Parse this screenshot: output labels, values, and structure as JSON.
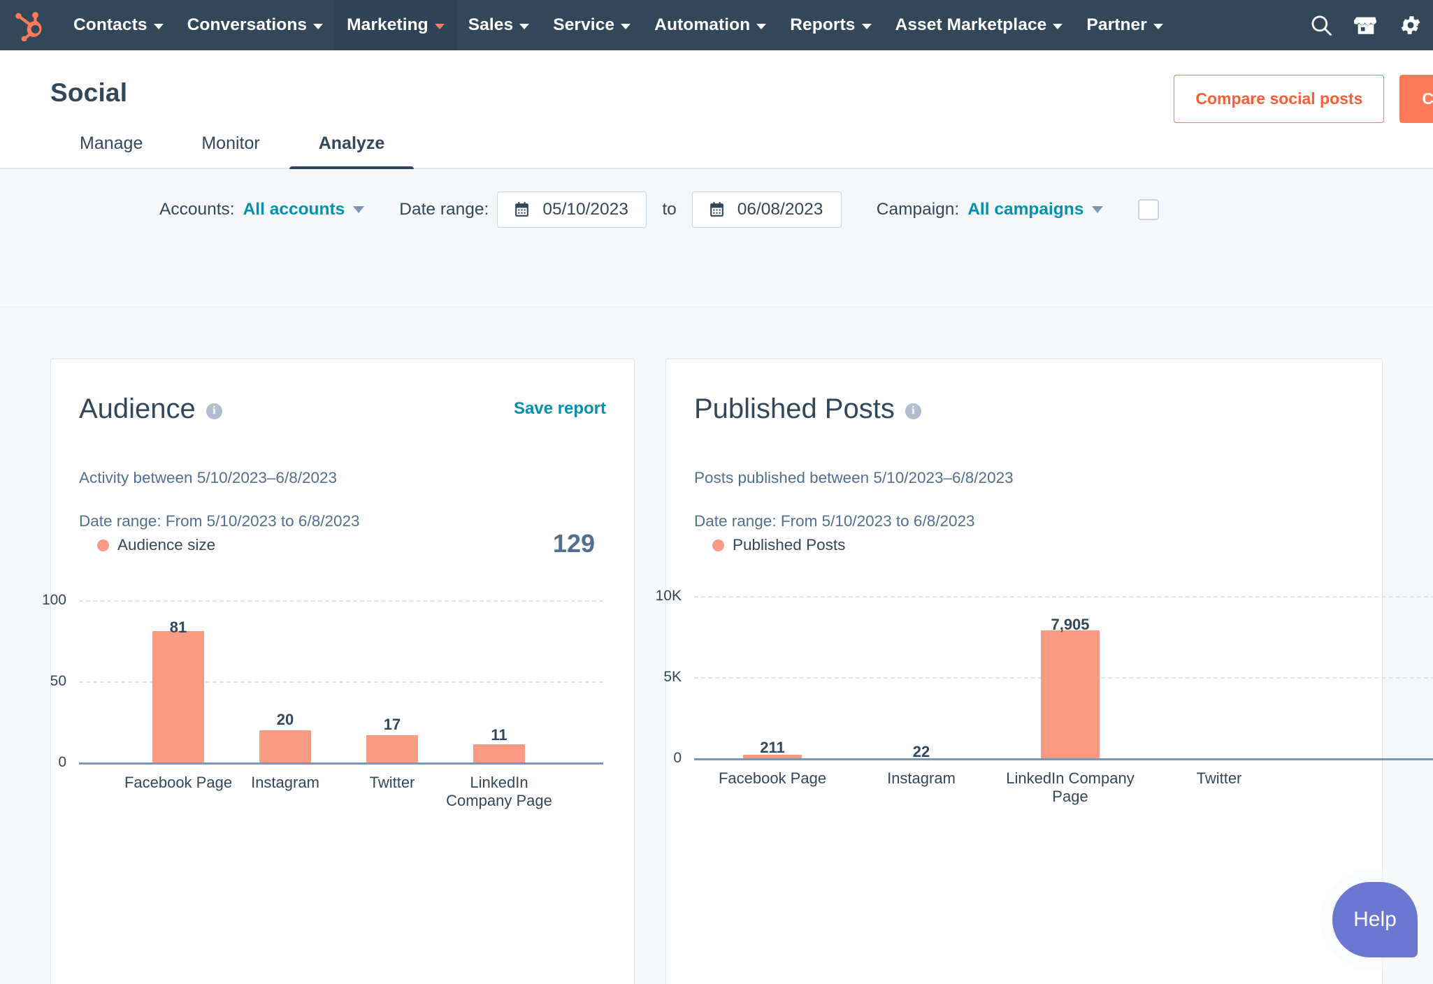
{
  "nav": {
    "logo": "hubspot-sprocket-logo",
    "items": [
      {
        "label": "Contacts",
        "has_caret": true,
        "active": false
      },
      {
        "label": "Conversations",
        "has_caret": true,
        "active": false
      },
      {
        "label": "Marketing",
        "has_caret": true,
        "active": true
      },
      {
        "label": "Sales",
        "has_caret": true,
        "active": false
      },
      {
        "label": "Service",
        "has_caret": true,
        "active": false
      },
      {
        "label": "Automation",
        "has_caret": true,
        "active": false
      },
      {
        "label": "Reports",
        "has_caret": true,
        "active": false
      },
      {
        "label": "Asset Marketplace",
        "has_caret": true,
        "active": false
      },
      {
        "label": "Partner",
        "has_caret": true,
        "active": false
      }
    ],
    "icons": [
      "search-icon",
      "marketplace-icon",
      "settings-gear-icon"
    ]
  },
  "header": {
    "title": "Social",
    "compare_button": "Compare social posts",
    "create_button": "Create"
  },
  "tabs": [
    {
      "label": "Manage",
      "active": false
    },
    {
      "label": "Monitor",
      "active": false
    },
    {
      "label": "Analyze",
      "active": true
    }
  ],
  "filters": {
    "accounts_label": "Accounts:",
    "accounts_value": "All accounts",
    "date_range_label": "Date range:",
    "date_from": "05/10/2023",
    "date_to": "06/08/2023",
    "to_label": "to",
    "campaign_label": "Campaign:",
    "campaign_value": "All campaigns",
    "checkbox_checked": false
  },
  "cards": [
    {
      "title": "Audience",
      "save_report": "Save report",
      "subtitle": "Activity between 5/10/2023–6/8/2023",
      "range": "Date range: From 5/10/2023 to 6/8/2023",
      "legend": "Audience size",
      "total": "129"
    },
    {
      "title": "Published Posts",
      "subtitle": "Posts published between 5/10/2023–6/8/2023",
      "range": "Date range: From 5/10/2023 to 6/8/2023",
      "legend": "Published Posts"
    }
  ],
  "help": {
    "label": "Help"
  },
  "colors": {
    "nav_bg": "#33475b",
    "accent_orange": "#ff7a59",
    "link_teal": "#0091ae",
    "bar_salmon": "#f89b82",
    "help_purple": "#6a78d1",
    "page_bg": "#f5f8fa"
  },
  "chart_data": [
    {
      "type": "bar",
      "title": "Audience",
      "series_name": "Audience size",
      "categories": [
        "Facebook Page",
        "Instagram",
        "Twitter",
        "LinkedIn Company Page"
      ],
      "values": [
        81,
        20,
        17,
        11
      ],
      "value_labels": [
        "81",
        "20",
        "17",
        "11"
      ],
      "ylabel": "",
      "xlabel": "",
      "ylim": [
        0,
        112
      ],
      "yticks": [
        0,
        50,
        100
      ],
      "ytick_labels": [
        "0",
        "50",
        "100"
      ],
      "grid": true,
      "legend_position": "top-left",
      "total_label": "129"
    },
    {
      "type": "bar",
      "title": "Published Posts",
      "series_name": "Published Posts",
      "categories": [
        "Facebook Page",
        "Instagram",
        "LinkedIn Company Page",
        "Twitter"
      ],
      "values": [
        211,
        22,
        7905,
        null
      ],
      "value_labels": [
        "211",
        "22",
        "7,905",
        ""
      ],
      "ylabel": "",
      "xlabel": "",
      "ylim": [
        0,
        11200
      ],
      "yticks": [
        0,
        5000,
        10000
      ],
      "ytick_labels": [
        "0",
        "5K",
        "10K"
      ],
      "grid": true,
      "legend_position": "top-left",
      "note": "fourth category (Twitter) is clipped at the right edge of the viewport"
    }
  ]
}
